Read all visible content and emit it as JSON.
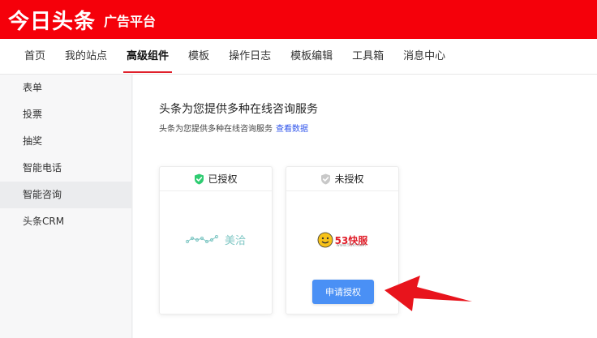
{
  "brand": {
    "logo": "今日头条",
    "subtitle": "广告平台"
  },
  "nav": {
    "items": [
      "首页",
      "我的站点",
      "高级组件",
      "模板",
      "操作日志",
      "模板编辑",
      "工具箱",
      "消息中心"
    ],
    "active_index": 2
  },
  "sidebar": {
    "items": [
      "表单",
      "投票",
      "抽奖",
      "智能电话",
      "智能咨询",
      "头条CRM"
    ],
    "active_index": 4
  },
  "main": {
    "title": "头条为您提供多种在线咨询服务",
    "subtitle": "头条为您提供多种在线咨询服务",
    "link": "查看数据"
  },
  "cards": [
    {
      "status": "已授权",
      "provider": "美洽",
      "authorized": true
    },
    {
      "status": "未授权",
      "provider": "53快服",
      "url": "www.53kf.com",
      "authorized": false,
      "button": "申请授权"
    }
  ],
  "colors": {
    "brand_red": "#f5000a",
    "accent_blue": "#4a90f5",
    "authorized_green": "#2ecc71",
    "unauthorized_gray": "#c8c8c8",
    "arrow_red": "#e8141c"
  },
  "icons": {
    "authorized": "shield-check-icon",
    "unauthorized": "shield-check-icon",
    "annotation": "red-arrow-icon"
  }
}
